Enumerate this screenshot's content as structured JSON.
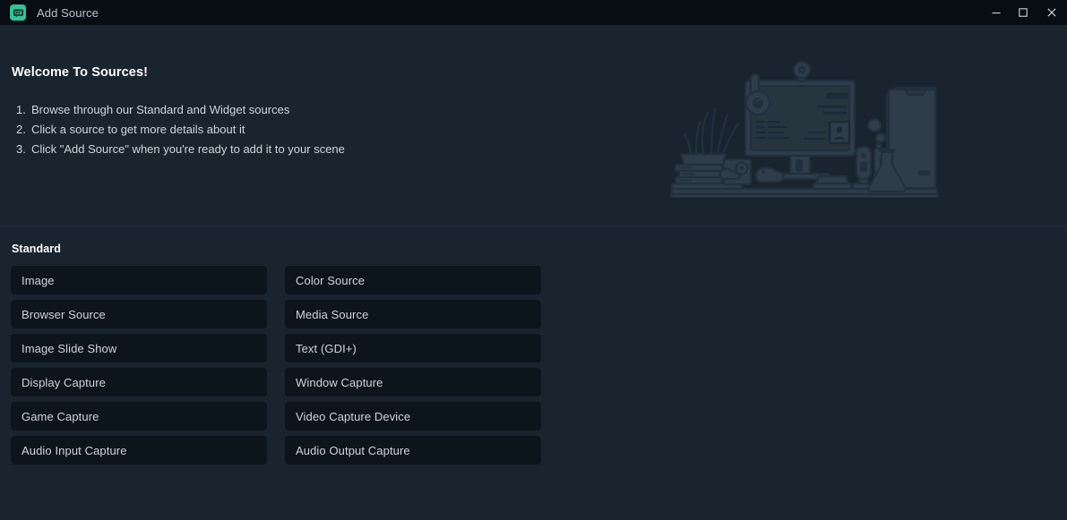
{
  "window": {
    "title": "Add Source",
    "icon": "obs-source-icon",
    "accent_color": "#31c496",
    "titlebar_bg": "#070d12",
    "body_bg": "#1a242e",
    "button_bg": "#0d151c",
    "controls": {
      "minimize_label": "Minimize",
      "maximize_label": "Maximize",
      "close_label": "Close"
    }
  },
  "hero": {
    "title": "Welcome To Sources!",
    "steps": [
      {
        "num": "1.",
        "text": "Browse through our Standard and Widget sources"
      },
      {
        "num": "2.",
        "text": "Click a source to get more details about it"
      },
      {
        "num": "3.",
        "text": "Click \"Add Source\" when you're ready to add it to your scene"
      }
    ],
    "illustration": "desk-setup-illustration"
  },
  "sources": {
    "section_label": "Standard",
    "items": [
      "Image",
      "Color Source",
      "Browser Source",
      "Media Source",
      "Image Slide Show",
      "Text (GDI+)",
      "Display Capture",
      "Window Capture",
      "Game Capture",
      "Video Capture Device",
      "Audio Input Capture",
      "Audio Output Capture"
    ]
  }
}
